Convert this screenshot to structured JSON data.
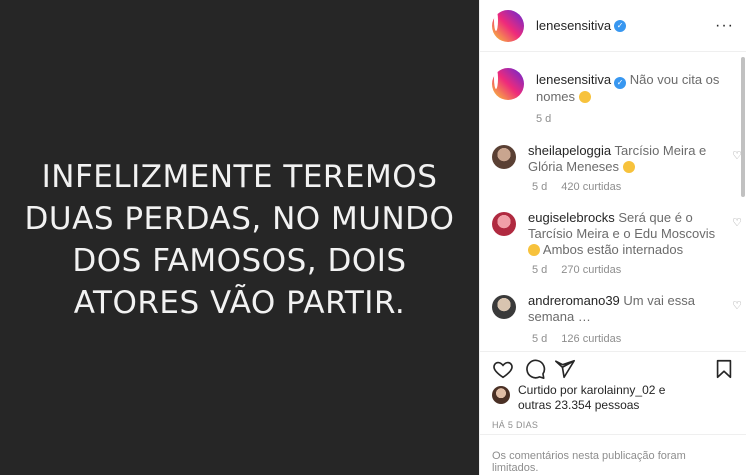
{
  "post": {
    "image_text": "INFELIZMENTE TEREMOS\nDUAS PERDAS, NO MUNDO\nDOS FAMOSOS, DOIS\nATORES VÃO PARTIR."
  },
  "header": {
    "username": "lenesensitiva",
    "more_icon": "···"
  },
  "caption": {
    "username": "lenesensitiva",
    "text": "Não vou cita os nomes",
    "time": "5 d"
  },
  "comments": [
    {
      "username": "sheilapeloggia",
      "text": "Tarcísio Meira e Glória Meneses",
      "time": "5 d",
      "likes": "420 curtidas"
    },
    {
      "username": "eugiselebrocks",
      "text": "Será que é o Tarcísio Meira e o Edu Moscovis",
      "text2": "Ambos estão internados",
      "time": "5 d",
      "likes": "270 curtidas"
    },
    {
      "username": "andreromano39",
      "text": "Um vai essa semana …",
      "time": "5 d",
      "likes": "126 curtidas"
    }
  ],
  "likes": {
    "prefix": "Curtido por",
    "user": "karolainny_02",
    "middle": "e",
    "others": "outras 23.354 pessoas"
  },
  "date": "HÁ 5 DIAS",
  "comments_limited": "Os comentários nesta publicação foram limitados.",
  "icons": {
    "verified": "verified-badge-icon",
    "more": "more-options-icon",
    "heart": "heart-icon",
    "comment": "comment-icon",
    "share": "share-icon",
    "save": "bookmark-icon"
  },
  "colors": {
    "verified": "#3897f0",
    "post_bg": "#262626",
    "muted": "#8e8e8e"
  }
}
